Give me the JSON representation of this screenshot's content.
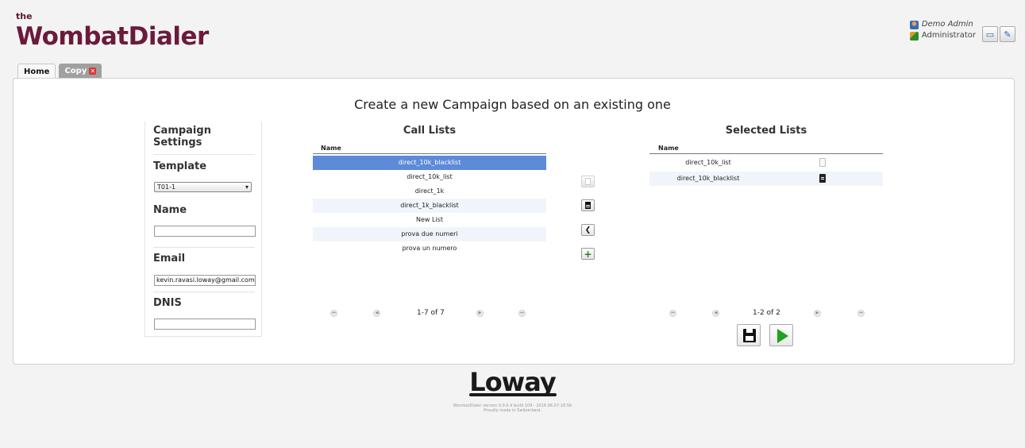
{
  "header": {
    "logo_prefix": "the",
    "logo_text": "WombatDialer",
    "user_name": "Demo Admin",
    "user_role": "Administrator"
  },
  "tabs": [
    {
      "label": "Home"
    },
    {
      "label": "Copy"
    }
  ],
  "page_title": "Create a new Campaign based on an existing one",
  "settings": {
    "title": "Campaign Settings",
    "template_label": "Template",
    "template_value": "T01-1",
    "name_label": "Name",
    "name_value": "",
    "email_label": "Email",
    "email_value": "kevin.ravasi.loway@gmail.com",
    "dnis_label": "DNIS",
    "dnis_value": ""
  },
  "call_lists": {
    "title": "Call Lists",
    "column": "Name",
    "rows": [
      "direct_10k_blacklist",
      "direct_10k_list",
      "direct_1k",
      "direct_1k_blacklist",
      "New List",
      "prova due numeri",
      "prova un numero"
    ],
    "pager": "1-7 of 7"
  },
  "selected_lists": {
    "title": "Selected Lists",
    "column": "Name",
    "rows": [
      "direct_10k_list",
      "direct_10k_blacklist"
    ],
    "pager": "1-2 of 2"
  },
  "footer": {
    "logo": "Loway",
    "version": "WombatDialer version 0.9.6.4 build 109 - 2016.06.07-16:56",
    "made_in": "Proudly made in Switzerland."
  }
}
